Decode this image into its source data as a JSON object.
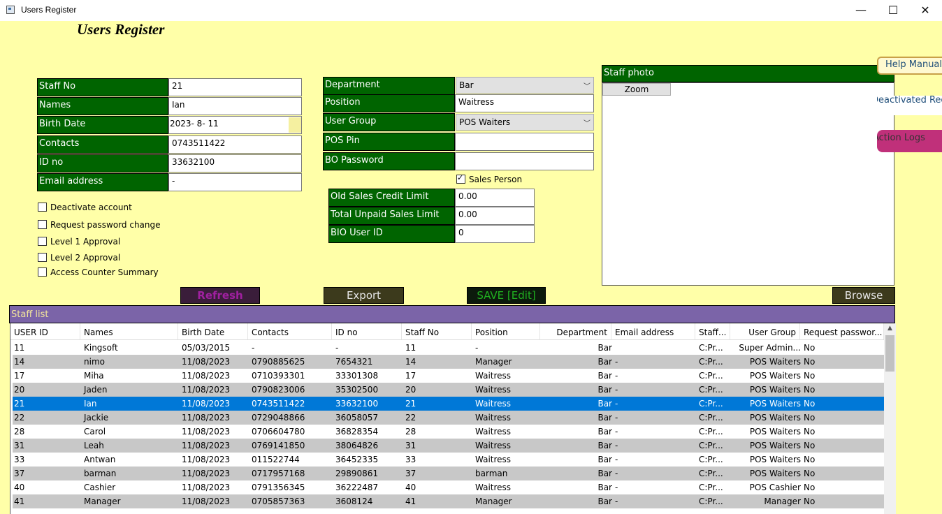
{
  "window": {
    "title": "Users Register",
    "minimize": "—",
    "maximize": "☐",
    "close": "✕"
  },
  "heading": "Users Register",
  "form_left": [
    {
      "label": "Staff No",
      "value": "21"
    },
    {
      "label": "Names",
      "value": "Ian"
    },
    {
      "label": "Birth Date",
      "value": "2023- 8- 11"
    },
    {
      "label": "Contacts",
      "value": "0743511422"
    },
    {
      "label": "ID no",
      "value": "33632100"
    },
    {
      "label": "Email address",
      "value": "-"
    }
  ],
  "checkboxes_left": [
    {
      "label": "Deactivate account",
      "checked": false
    },
    {
      "label": "Request password change",
      "checked": false
    },
    {
      "label": "Level 1 Approval",
      "checked": false
    },
    {
      "label": "Level 2 Approval",
      "checked": false
    },
    {
      "label": "Access Counter Summary",
      "checked": false
    }
  ],
  "form_mid": {
    "department": {
      "label": "Department",
      "value": "Bar"
    },
    "position": {
      "label": "Position",
      "value": "Waitress"
    },
    "user_group": {
      "label": "User Group",
      "value": "POS Waiters"
    },
    "pos_pin": {
      "label": "POS Pin",
      "value": ""
    },
    "bo_password": {
      "label": "BO Password",
      "value": ""
    },
    "sales_person": {
      "label": "Sales Person",
      "checked": true
    },
    "old_credit": {
      "label": "Old Sales Credit Limit",
      "value": "0.00"
    },
    "unpaid_limit": {
      "label": "Total Unpaid Sales Limit",
      "value": "0.00"
    },
    "bio_id": {
      "label": "BIO User ID",
      "value": "0"
    }
  },
  "photo": {
    "header": "Staff photo",
    "zoom": "Zoom"
  },
  "side_buttons": {
    "help": "Help Manual",
    "deactivated": "Deactivated Records",
    "action_logs": "Action Logs"
  },
  "buttons": {
    "refresh": "Refresh",
    "export": "Export",
    "save": "SAVE [Edit]",
    "browse": "Browse"
  },
  "colors": {
    "background": "#ffffa8",
    "label_green": "#006400",
    "panel_purple": "#7b64a8",
    "selected_row": "#0078d7"
  },
  "staff_list": {
    "header": "Staff list",
    "columns": [
      "USER ID",
      "Names",
      "Birth Date",
      "Contacts",
      "ID no",
      "Staff No",
      "Position",
      "Department",
      "Email address",
      "Staff...",
      "User Group",
      "Request passwor..."
    ],
    "rows": [
      [
        "11",
        "Kingsoft",
        "05/03/2015",
        "-",
        "-",
        "11",
        "-",
        "Bar",
        "",
        "C:Pr...",
        "Super Admin...",
        "No"
      ],
      [
        "14",
        "nimo",
        "11/08/2023",
        "0790885625",
        "7654321",
        "14",
        "Manager",
        "Bar",
        "-",
        "C:Pr...",
        "POS Waiters",
        "No"
      ],
      [
        "17",
        "Miha",
        "11/08/2023",
        "0710393301",
        "33301308",
        "17",
        "Waitress",
        "Bar",
        "-",
        "C:Pr...",
        "POS Waiters",
        "No"
      ],
      [
        "20",
        "Jaden",
        "11/08/2023",
        "0790823006",
        "35302500",
        "20",
        "Waitress",
        "Bar",
        "-",
        "C:Pr...",
        "POS Waiters",
        "No"
      ],
      [
        "21",
        "Ian",
        "11/08/2023",
        "0743511422",
        "33632100",
        "21",
        "Waitress",
        "Bar",
        "-",
        "C:Pr...",
        "POS Waiters",
        "No"
      ],
      [
        "22",
        "Jackie",
        "11/08/2023",
        "0729048866",
        "36058057",
        "22",
        "Waitress",
        "Bar",
        "-",
        "C:Pr...",
        "POS Waiters",
        "No"
      ],
      [
        "28",
        "Carol",
        "11/08/2023",
        "0706604780",
        "36828354",
        "28",
        "Waitress",
        "Bar",
        "-",
        "C:Pr...",
        "POS Waiters",
        "No"
      ],
      [
        "31",
        "Leah",
        "11/08/2023",
        "0769141850",
        "38064826",
        "31",
        "Waitress",
        "Bar",
        "-",
        "C:Pr...",
        "POS Waiters",
        "No"
      ],
      [
        "33",
        "Antwan",
        "11/08/2023",
        "011522744",
        "36452335",
        "33",
        "Waitress",
        "Bar",
        "-",
        "C:Pr...",
        "POS Waiters",
        "No"
      ],
      [
        "37",
        "barman",
        "11/08/2023",
        "0717957168",
        "29890861",
        "37",
        "barman",
        "Bar",
        "-",
        "C:Pr...",
        "POS Waiters",
        "No"
      ],
      [
        "40",
        "Cashier",
        "11/08/2023",
        "0791356345",
        "36222487",
        "40",
        "Waitress",
        "Bar",
        "-",
        "C:Pr...",
        "POS Cashier",
        "No"
      ],
      [
        "41",
        "Manager",
        "11/08/2023",
        "0705857363",
        "3608124",
        "41",
        "Manager",
        "Bar",
        "-",
        "C:Pr...",
        "Manager",
        "No"
      ]
    ],
    "selected_index": 4
  }
}
